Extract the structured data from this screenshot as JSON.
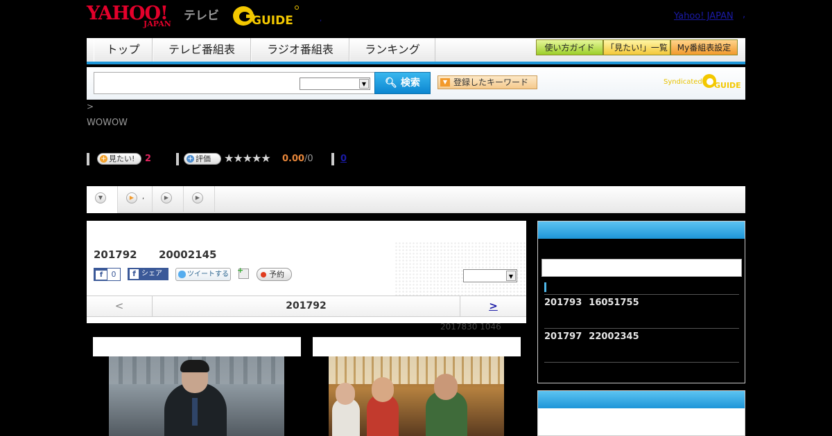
{
  "header": {
    "yahoo_logo": "YAHOO!",
    "yahoo_sub": "JAPAN",
    "tv_label": "テレビ",
    "gguide_logo": "GUIDE",
    "yahoo_japan_link": "Yahoo! JAPAN",
    "link_sep": ",",
    "dot": ","
  },
  "nav": {
    "items": [
      "トップ",
      "テレビ番組表",
      "ラジオ番組表",
      "ランキング"
    ],
    "guide_buttons": [
      "使い方ガイド",
      "「見たい!」一覧",
      "My番組表設定"
    ]
  },
  "search": {
    "button_label": "検索",
    "keyword_button": "登録したキーワード",
    "syndicated": "Syndicated",
    "syndicated_logo": "GUIDE",
    "select_arrow": "▼"
  },
  "breadcrumb": ">",
  "channel": "WOWOW",
  "rating": {
    "mitai_label": "見たい!",
    "mitai_count": "2",
    "hyoka_label": "評価",
    "stars": "★★★★★",
    "score": "0.00",
    "score_of": "/0",
    "review_link": "0"
  },
  "tabs": [
    {
      "icon": "▼",
      "label": ""
    },
    {
      "icon": "▶",
      "label": ","
    },
    {
      "icon": "▶",
      "label": ""
    },
    {
      "icon": "▶",
      "label": ""
    }
  ],
  "program": {
    "date": "201792",
    "time": "20002145",
    "fb_like": "f",
    "fb_like_count": "0",
    "fb_share": "シェア",
    "tweet": "ツイートする",
    "reserve": "予約",
    "pager_prev": "<",
    "pager_date": "201792",
    "pager_next": ">",
    "updated": "2017830  1046"
  },
  "sidebar": {
    "items": [
      {
        "date": "201793",
        "time": "16051755"
      },
      {
        "date": "201797",
        "time": "22002345"
      }
    ]
  },
  "colors": {
    "accent_blue": "#1e96d8",
    "mitai_red": "#e0245e",
    "score_orange": "#e8863a",
    "link_blue": "#1a1aa6"
  }
}
